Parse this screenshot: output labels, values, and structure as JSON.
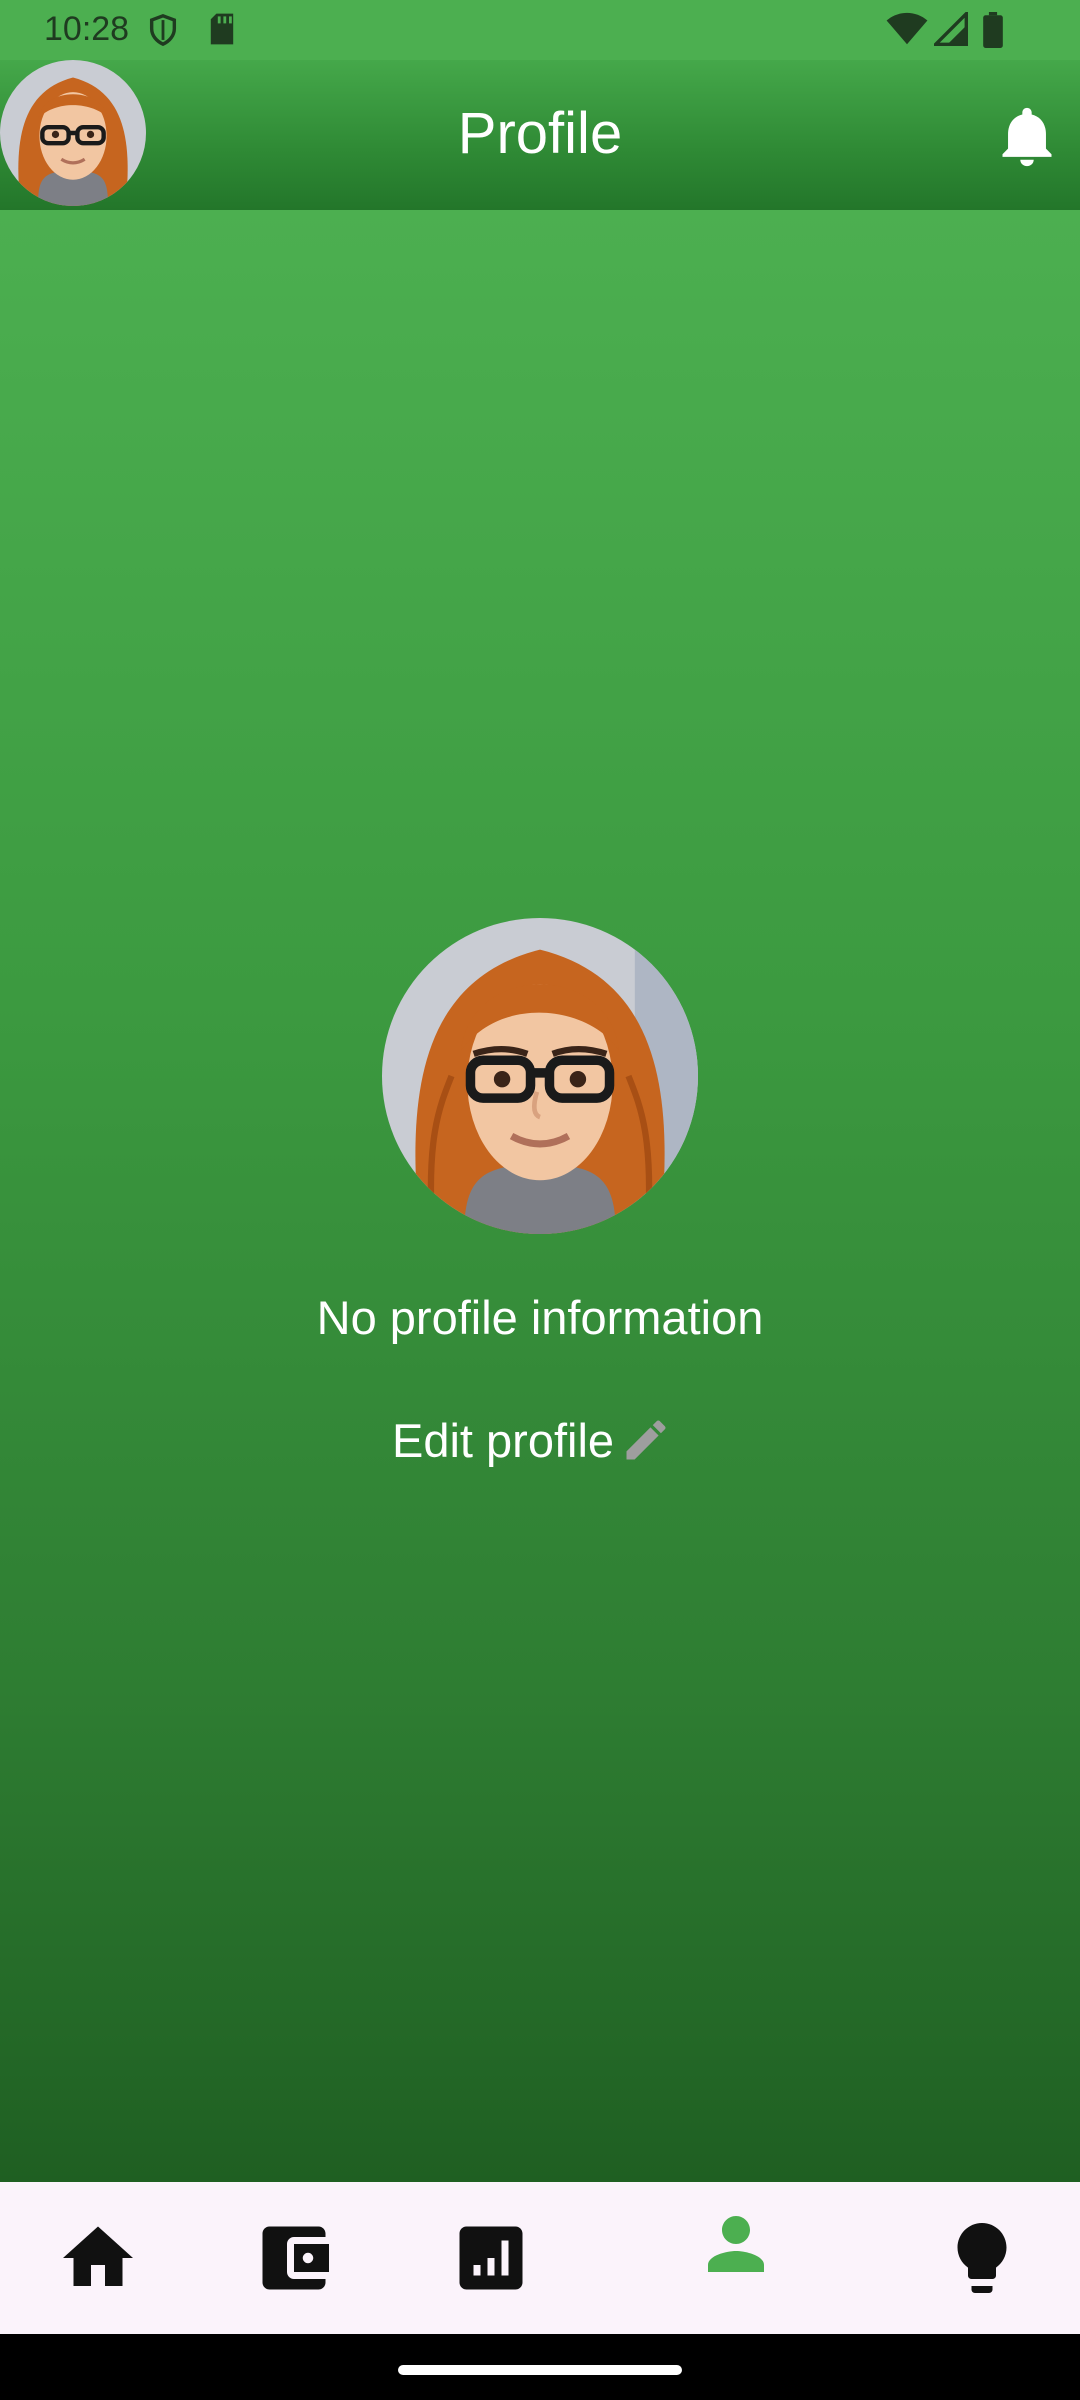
{
  "status_bar": {
    "time": "10:28",
    "icons": [
      "shield-icon",
      "sd-card-icon",
      "wifi-icon",
      "cellular-signal-icon",
      "battery-icon"
    ]
  },
  "app_bar": {
    "title": "Profile",
    "avatar_icon": "user-avatar",
    "action_icon": "bell-icon"
  },
  "profile": {
    "message": "No profile information",
    "edit_label": "Edit profile",
    "edit_icon": "pencil-icon"
  },
  "bottom_nav": {
    "items": [
      {
        "icon": "home-icon",
        "active": false
      },
      {
        "icon": "wallet-icon",
        "active": false
      },
      {
        "icon": "bar-chart-icon",
        "active": false
      },
      {
        "icon": "person-icon",
        "active": true
      },
      {
        "icon": "lightbulb-icon",
        "active": false
      }
    ],
    "active_color": "#4caf50",
    "inactive_color": "#111111"
  },
  "colors": {
    "primary_green": "#4caf50",
    "dark_green": "#1f5f22",
    "nav_background": "#fbf3fb"
  }
}
